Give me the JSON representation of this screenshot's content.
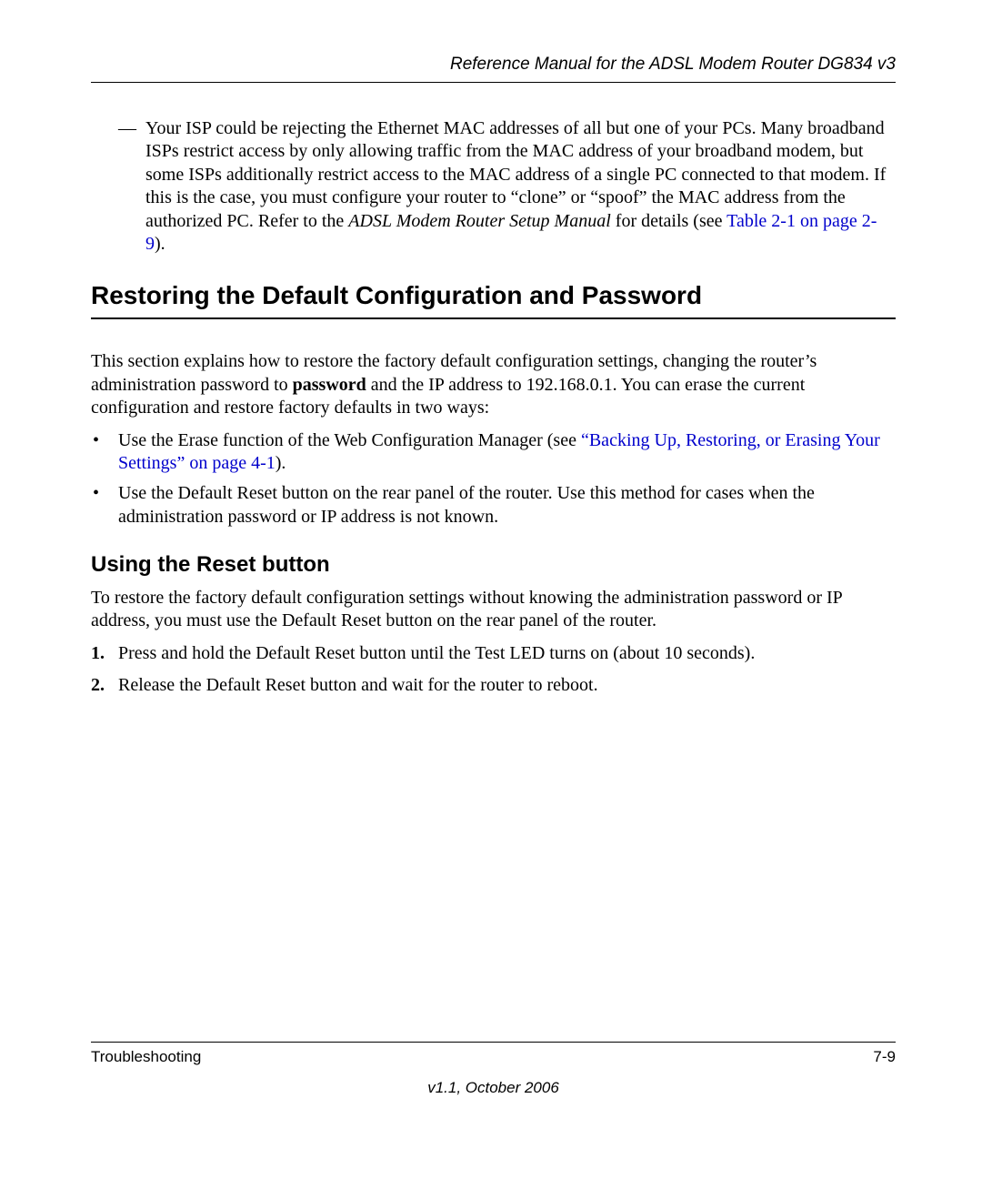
{
  "header": {
    "title": "Reference Manual for the ADSL Modem Router DG834 v3"
  },
  "dash": {
    "marker": "—",
    "part1": "Your ISP could be rejecting the Ethernet MAC addresses of all but one of your PCs. Many broadband ISPs restrict access by only allowing traffic from the MAC address of your broadband modem, but some ISPs additionally restrict access to the MAC address of a single PC connected to that modem. If this is the case, you must configure your router to “clone” or “spoof” the MAC address from the authorized PC. Refer to the ",
    "ref_italic": "ADSL Modem Router Setup Manual",
    "part2": " for details (see ",
    "link": "Table 2-1 on page 2-9",
    "part3": ")."
  },
  "heading1": "Restoring the Default Configuration and Password",
  "intro": {
    "part1": "This section explains how to restore the factory default configuration settings, changing the router’s administration password to ",
    "bold": "password",
    "part2": " and the IP address to 192.168.0.1. You can erase the current configuration and restore factory defaults in two ways:"
  },
  "bullets": [
    {
      "marker": "•",
      "part1": "Use the Erase function of the Web Configuration Manager (see ",
      "link": "“Backing Up, Restoring, or Erasing Your Settings” on page 4-1",
      "part2": ")."
    },
    {
      "marker": "•",
      "part1": "Use the Default Reset button on the rear panel of the router. Use this method for cases when the administration password or IP address is not known.",
      "link": "",
      "part2": ""
    }
  ],
  "heading2": "Using the Reset button",
  "sub_intro": "To restore the factory default configuration settings without knowing the administration password or IP address, you must use the Default Reset button on the rear panel of the router.",
  "steps": [
    {
      "num": "1.",
      "text": "Press and hold the Default Reset button until the Test LED turns on (about 10 seconds)."
    },
    {
      "num": "2.",
      "text": "Release the Default Reset button and wait for the router to reboot."
    }
  ],
  "footer": {
    "left": "Troubleshooting",
    "right": "7-9",
    "version": "v1.1, October 2006"
  }
}
